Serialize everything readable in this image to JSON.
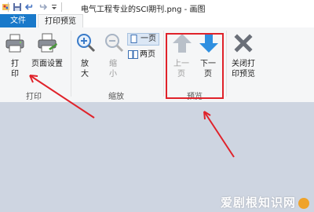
{
  "title_bar": {
    "title": "电气工程专业的SCI期刊.png - 画图"
  },
  "tabs": [
    {
      "label": "文件"
    },
    {
      "label": "打印预览"
    }
  ],
  "groups": {
    "print": {
      "label": "打印",
      "print_btn": "打\n印",
      "page_setup_btn": "页面设置"
    },
    "zoom": {
      "label": "缩放",
      "zoom_in": "放\n大",
      "zoom_out": "缩\n小",
      "one_page": "一页",
      "two_page": "两页"
    },
    "preview": {
      "label": "预览",
      "prev_page": "上一\n页",
      "next_page": "下一\n页"
    },
    "close": {
      "close_preview": "关闭打\n印预览"
    }
  },
  "watermark": "爱剧根知识网",
  "colors": {
    "file_tab": "#1979ca",
    "highlight": "#e0222a",
    "canvas": "#ced5e1",
    "ribbon": "#f5f6f7"
  }
}
